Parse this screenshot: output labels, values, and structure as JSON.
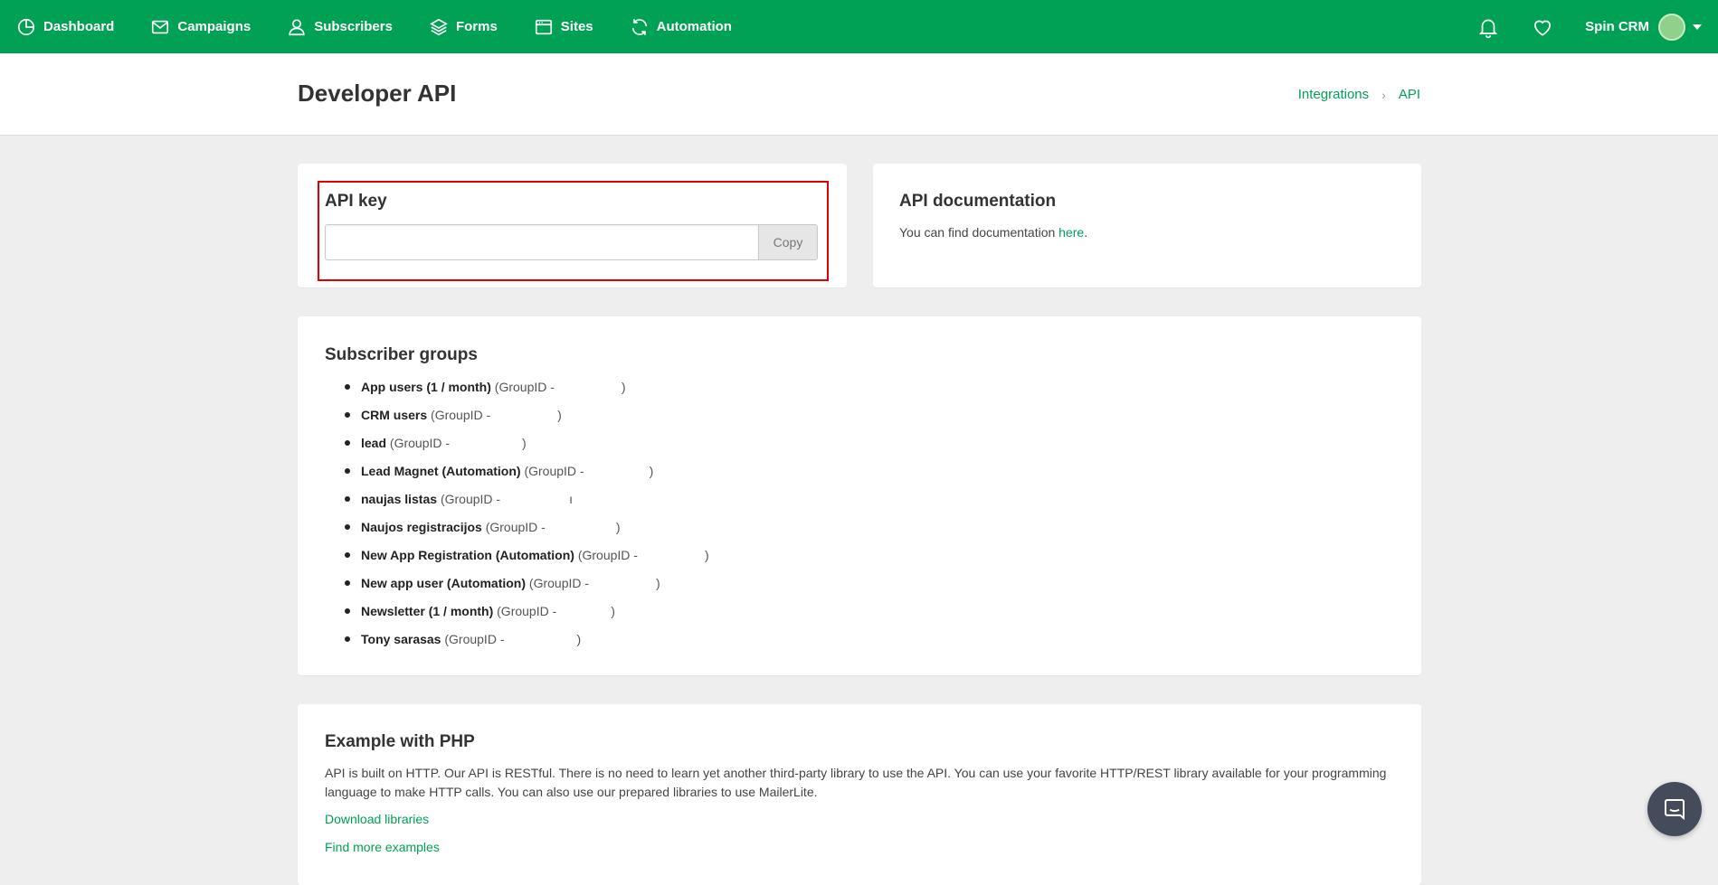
{
  "nav": {
    "items": [
      {
        "label": "Dashboard",
        "icon": "dashboard-icon"
      },
      {
        "label": "Campaigns",
        "icon": "envelope-icon"
      },
      {
        "label": "Subscribers",
        "icon": "user-icon"
      },
      {
        "label": "Forms",
        "icon": "layers-icon"
      },
      {
        "label": "Sites",
        "icon": "browser-icon"
      },
      {
        "label": "Automation",
        "icon": "refresh-icon"
      }
    ],
    "account_name": "Spin CRM"
  },
  "header": {
    "title": "Developer API",
    "breadcrumb": [
      "Integrations",
      "API"
    ]
  },
  "api_key": {
    "title": "API key",
    "value": "",
    "copy_label": "Copy"
  },
  "docs": {
    "title": "API documentation",
    "text": "You can find documentation",
    "link": "here",
    "period": "."
  },
  "groups": {
    "title": "Subscriber groups",
    "items": [
      {
        "name": "App users (1 / month)",
        "suffix": "(GroupID -",
        "close": ")"
      },
      {
        "name": "CRM users",
        "suffix": "(GroupID -",
        "close": ")"
      },
      {
        "name": "lead",
        "suffix": "(GroupID -",
        "close": ")"
      },
      {
        "name": "Lead Magnet (Automation)",
        "suffix": "(GroupID -",
        "close": ")"
      },
      {
        "name": "naujas listas",
        "suffix": "(GroupID -",
        "close": "ı"
      },
      {
        "name": "Naujos registracijos",
        "suffix": "(GroupID -",
        "close": ")"
      },
      {
        "name": "New App Registration (Automation)",
        "suffix": "(GroupID -",
        "close": ")"
      },
      {
        "name": "New app user (Automation)",
        "suffix": "(GroupID -",
        "close": ")"
      },
      {
        "name": "Newsletter (1 / month)",
        "suffix": "(GroupID -",
        "close": ")"
      },
      {
        "name": "Tony sarasas",
        "suffix": "(GroupID -",
        "close": ")"
      }
    ]
  },
  "php": {
    "title": "Example with PHP",
    "text": "API is built on HTTP. Our API is RESTful. There is no need to learn yet another third-party library to use the API. You can use your favorite HTTP/REST library available for your programming language to make HTTP calls. You can also use our prepared libraries to use MailerLite.",
    "download_link": "Download libraries",
    "examples_link": "Find more examples"
  },
  "colors": {
    "brand": "#00a154",
    "highlight": "#e00000"
  }
}
